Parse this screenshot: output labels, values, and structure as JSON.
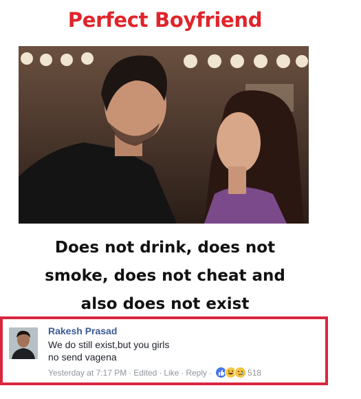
{
  "meme": {
    "title": "Perfect Boyfriend",
    "caption_lines": [
      "Does not drink, does not",
      "smoke, does not cheat and",
      "also does not exist"
    ]
  },
  "comment": {
    "author": "Rakesh Prasad",
    "text": "We do still exist,but you girls\nno send vagena",
    "timestamp": "Yesterday at 7:17 PM",
    "edited_label": "Edited",
    "like_label": "Like",
    "reply_label": "Reply",
    "separator": "·",
    "reaction_count": "518",
    "reactions": [
      "like-icon",
      "haha-icon",
      "sad-icon"
    ]
  },
  "colors": {
    "title_red": "#e0242b",
    "border_red": "#d9263f",
    "author_blue": "#3b5998",
    "meta_gray": "#90949c"
  }
}
